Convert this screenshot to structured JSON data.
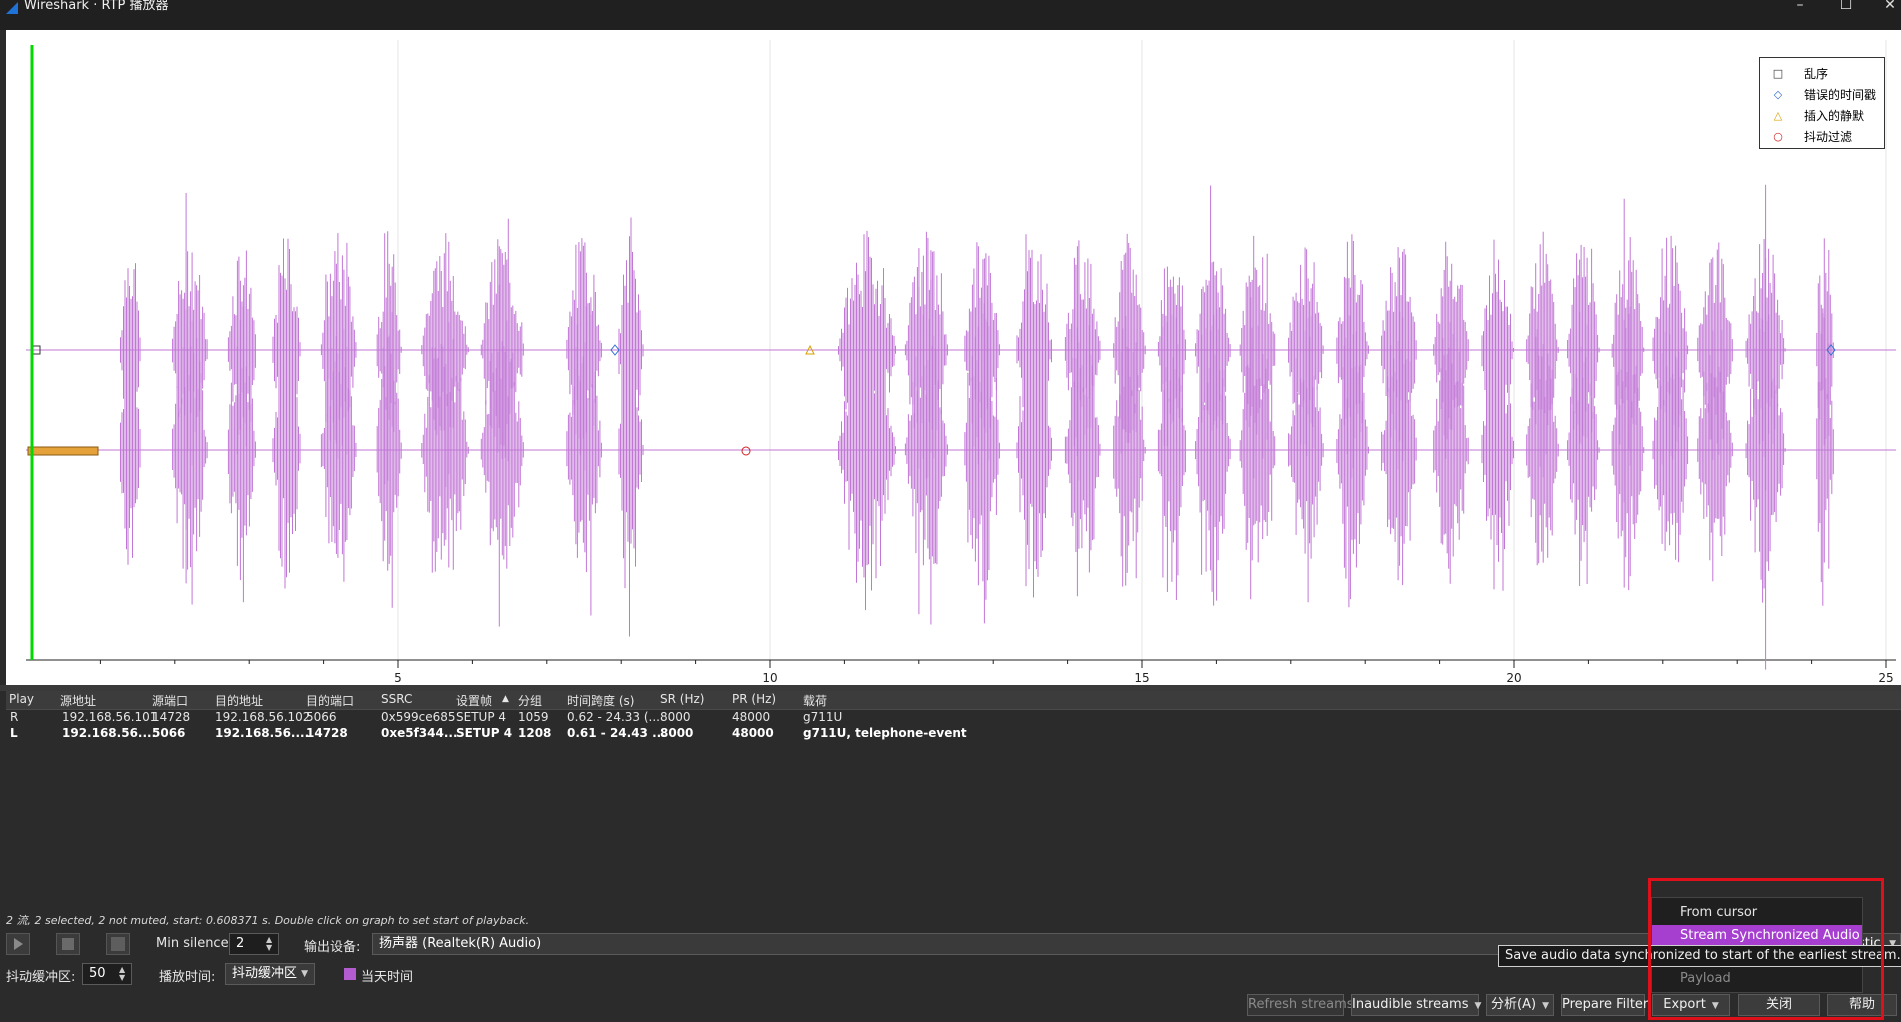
{
  "window": {
    "title": "Wireshark · RTP 播放器"
  },
  "legend": [
    {
      "symbol": "square",
      "color": "#333333",
      "label": "乱序"
    },
    {
      "symbol": "diamond",
      "color": "#2f6fd0",
      "label": "错误的时间戳"
    },
    {
      "symbol": "triangle",
      "color": "#d8a000",
      "label": "插入的静默"
    },
    {
      "symbol": "circle",
      "color": "#d02020",
      "label": "抖动过滤"
    }
  ],
  "chart_data": {
    "type": "line",
    "xlim": [
      0,
      25
    ],
    "x_ticks": [
      "5",
      "10",
      "15",
      "20",
      "25"
    ],
    "series": [
      {
        "name": "R",
        "color": "#c177d6"
      },
      {
        "name": "L",
        "color": "#c177d6"
      }
    ],
    "cursor_color": "#00d800"
  },
  "table": {
    "columns": [
      "Play",
      "源地址",
      "源端口",
      "目的地址",
      "目的端口",
      "SSRC",
      "设置帧",
      "分组",
      "时间跨度 (s)",
      "SR (Hz)",
      "PR (Hz)",
      "载荷"
    ],
    "rows": [
      {
        "selected": false,
        "cells": [
          "R",
          "192.168.56.101",
          "14728",
          "192.168.56.102",
          "5066",
          "0x599ce685",
          "SETUP 4",
          "1059",
          "0.62 - 24.33 (...",
          "8000",
          "48000",
          "g711U"
        ]
      },
      {
        "selected": true,
        "cells": [
          "L",
          "192.168.56....",
          "5066",
          "192.168.56....",
          "14728",
          "0xe5f344...",
          "SETUP 4",
          "1208",
          "0.61 - 24.43 ...",
          "8000",
          "48000",
          "g711U, telephone-event"
        ]
      }
    ]
  },
  "status_text": "2 流, 2 selected, 2 not muted, start: 0.608371 s. Double click on graph to set start of playback.",
  "controls": {
    "min_silence_label": "Min silence:",
    "min_silence_value": "2",
    "output_device_label": "输出设备:",
    "output_device_value": "扬声器 (Realtek(R) Audio)",
    "jitter_buffer_label": "抖动缓冲区:",
    "jitter_buffer_value": "50",
    "playback_time_label": "播放时间:",
    "playback_time_value": "抖动缓冲区",
    "current_time_label": "当天时间",
    "right_combo_partial": "stic"
  },
  "buttons": {
    "refresh_streams": "Refresh streams",
    "inaudible_streams": "Inaudible streams",
    "analyze": "分析(A)",
    "prepare_filter": "Prepare Filter",
    "export": "Export",
    "close": "关闭",
    "help": "帮助"
  },
  "export_menu": {
    "items": [
      {
        "label": "From cursor",
        "state": "normal"
      },
      {
        "label": "Stream Synchronized Audio",
        "state": "highlighted"
      },
      {
        "label": "Payload",
        "state": "disabled"
      }
    ]
  },
  "tooltip": "Save audio data synchronized to start of the earliest stream."
}
